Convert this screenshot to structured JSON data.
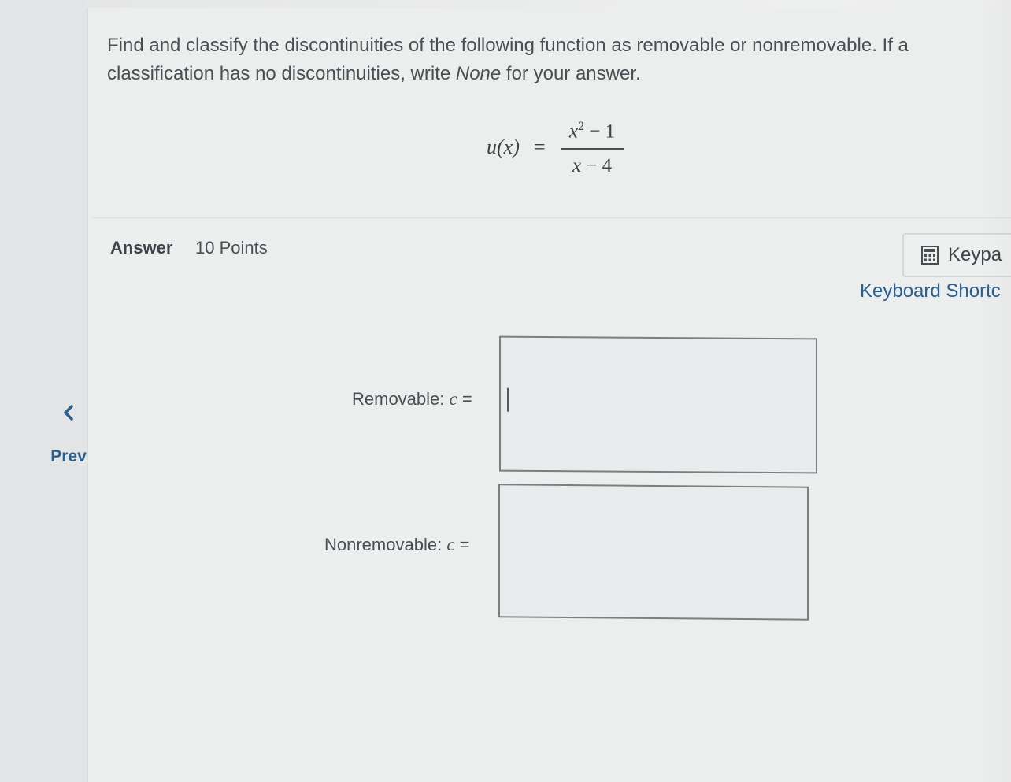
{
  "question": {
    "text_part1": "Find and classify the discontinuities of the following function as removable or nonremovable. If a classification has no discontinuities, write ",
    "text_emphasis": "None",
    "text_part2": " for your answer."
  },
  "formula": {
    "lhs": "u(x)",
    "equals": "=",
    "numerator_base": "x",
    "numerator_exponent": "2",
    "numerator_rest": " − 1",
    "denominator_var": "x",
    "denominator_rest": " − 4"
  },
  "answer": {
    "label": "Answer",
    "points": "10 Points"
  },
  "toolbar": {
    "keypad_label": "Keypa",
    "shortcuts_label": "Keyboard Shortc"
  },
  "fields": {
    "removable_label": "Removable: ",
    "nonremovable_label": "Nonremovable: ",
    "variable": "c",
    "equals": "=",
    "removable_value": "",
    "nonremovable_value": ""
  },
  "nav": {
    "prev_label": "Prev"
  },
  "colors": {
    "link": "#2a5f8f",
    "text": "#4a4d52",
    "box_border": "#7b7e83"
  }
}
